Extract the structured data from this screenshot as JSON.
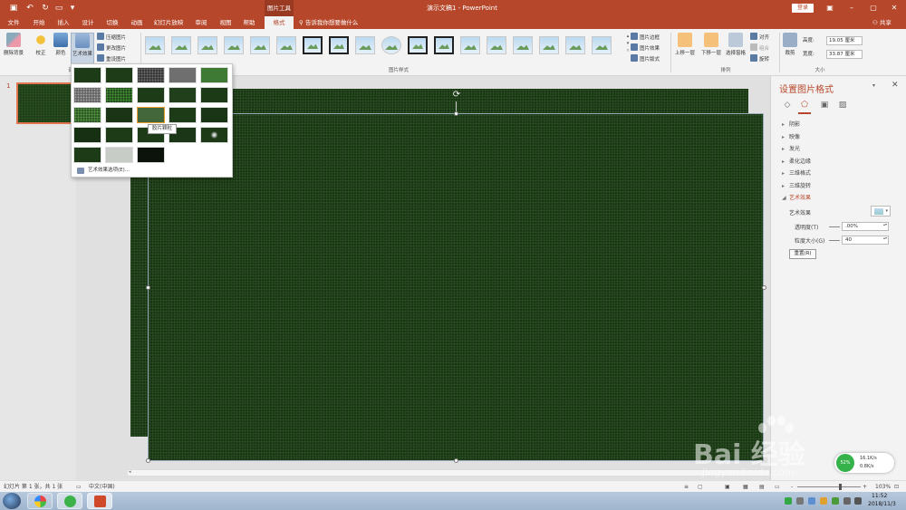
{
  "window": {
    "title": "演示文稿1 - PowerPoint",
    "context_label": "图片工具",
    "login": "登录"
  },
  "tabs": [
    {
      "label": "文件"
    },
    {
      "label": "开始"
    },
    {
      "label": "插入"
    },
    {
      "label": "设计"
    },
    {
      "label": "切换"
    },
    {
      "label": "动画"
    },
    {
      "label": "幻灯片放映"
    },
    {
      "label": "审阅"
    },
    {
      "label": "视图"
    },
    {
      "label": "帮助"
    },
    {
      "label": "格式"
    }
  ],
  "tell_me": "告诉我你想要做什么",
  "share": "共享",
  "ribbon": {
    "remove_bg": "删除背景",
    "corrections": "校正",
    "color": "颜色",
    "artistic_effects": "艺术效果",
    "compress": "压缩图片",
    "change_picture": "更改图片",
    "reset_picture": "重设图片",
    "adjust_group": "调",
    "styles_group": "图片样式",
    "border": "图片边框",
    "effects": "图片效果",
    "layout": "图片版式",
    "bring_forward": "上移一层",
    "send_backward": "下移一层",
    "selection_pane": "选择窗格",
    "align": "对齐",
    "group": "组合",
    "rotate": "旋转",
    "arrange_group": "排列",
    "crop": "裁剪",
    "height_label": "高度:",
    "height_value": "19.05 厘米",
    "width_label": "宽度:",
    "width_value": "33.87 厘米",
    "size_group": "大小"
  },
  "slide_panel": {
    "number": "1"
  },
  "effects_dropdown": {
    "tooltip": "胶片颗粒",
    "options_link": "艺术效果选项(E)..."
  },
  "format_pane": {
    "title": "设置图片格式",
    "sections": [
      {
        "label": "阴影",
        "open": false
      },
      {
        "label": "映像",
        "open": false
      },
      {
        "label": "发光",
        "open": false
      },
      {
        "label": "柔化边缘",
        "open": false
      },
      {
        "label": "三维格式",
        "open": false
      },
      {
        "label": "三维旋转",
        "open": false
      },
      {
        "label": "艺术效果",
        "open": true
      }
    ],
    "artistic_effect_label": "艺术效果",
    "transparency_label": "透明度(T)",
    "transparency_value": ".00%",
    "grain_label": "粒度大小(G)",
    "grain_value": "40",
    "reset": "重置(R)"
  },
  "status": {
    "slide_info": "幻灯片 第 1 张，共 1 张",
    "language": "中文(中国)",
    "zoom": "103%"
  },
  "taskbar": {
    "time": "11:52",
    "date": "2018/11/3"
  },
  "net_speed": {
    "up": "16.1K/s",
    "down": "0.8K/s",
    "ball": "52%"
  },
  "watermark": {
    "logo": "Bai  经验",
    "url": "jingyan.baidu.com"
  },
  "colors": {
    "accent": "#b7472a",
    "slide_background": "#1e3b18"
  }
}
